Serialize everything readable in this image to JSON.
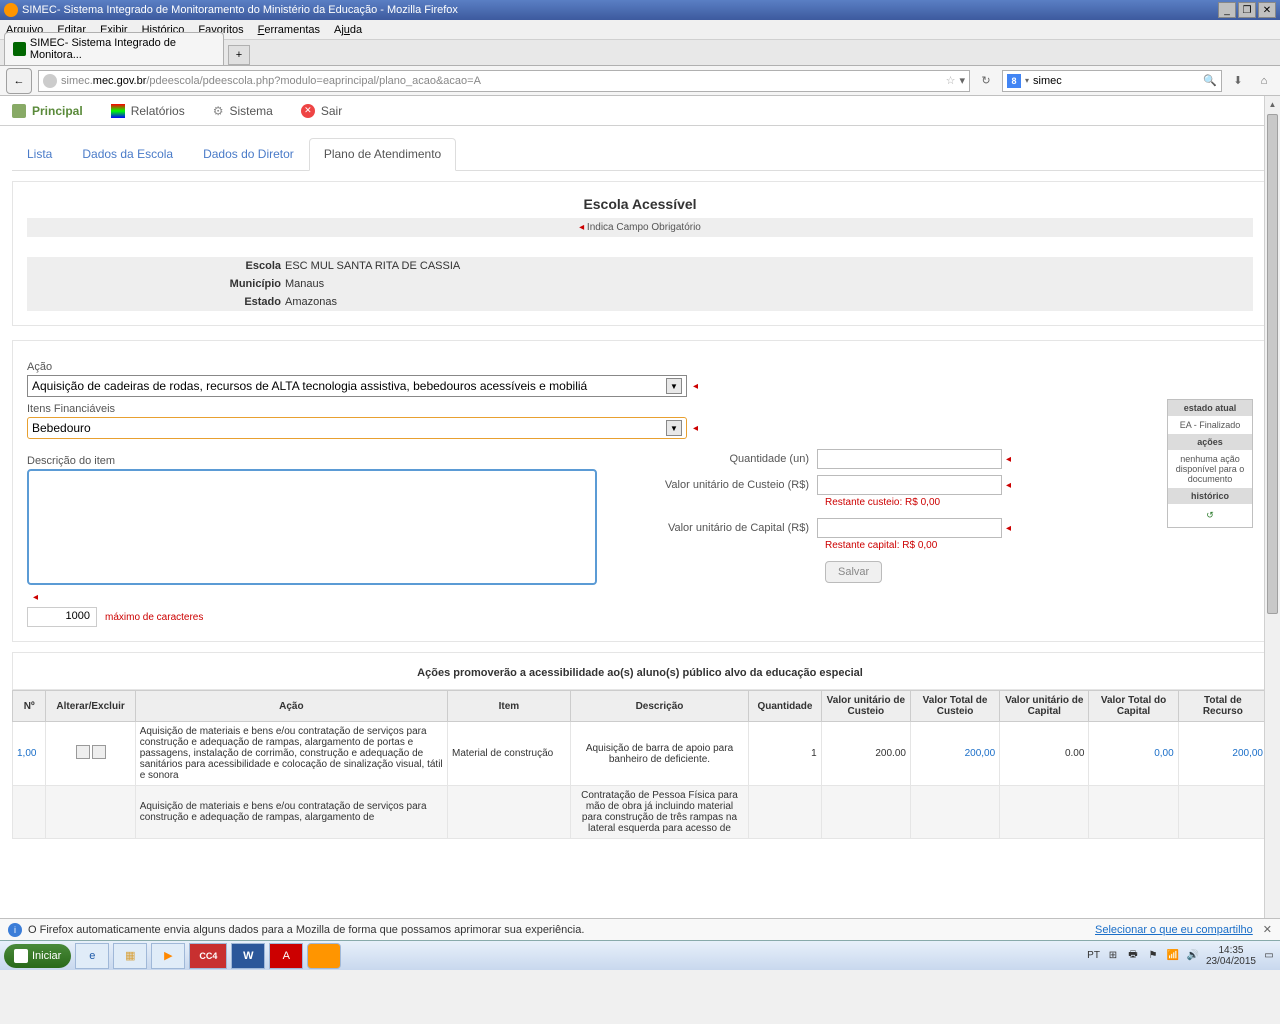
{
  "window": {
    "title": "SIMEC- Sistema Integrado de Monitoramento do Ministério da Educação - Mozilla Firefox"
  },
  "menubar": {
    "arquivo": "Arquivo",
    "editar": "Editar",
    "exibir": "Exibir",
    "historico": "Histórico",
    "favoritos": "Favoritos",
    "ferramentas": "Ferramentas",
    "ajuda": "Ajuda"
  },
  "browser_tab": {
    "label": "SIMEC- Sistema Integrado de Monitora..."
  },
  "url": "simec.mec.gov.br/pdeescola/pdeescola.php?modulo=eaprincipal/plano_acao&acao=A",
  "searchbox": {
    "value": "simec"
  },
  "topnav": {
    "principal": "Principal",
    "relatorios": "Relatórios",
    "sistema": "Sistema",
    "sair": "Sair"
  },
  "tabs": {
    "lista": "Lista",
    "dados_escola": "Dados da Escola",
    "dados_diretor": "Dados do Diretor",
    "plano": "Plano de Atendimento"
  },
  "panel": {
    "title": "Escola Acessível",
    "req_note": "Indica Campo Obrigatório",
    "escola_lbl": "Escola",
    "escola_val": "ESC MUL SANTA RITA DE CASSIA",
    "municipio_lbl": "Município",
    "municipio_val": "Manaus",
    "estado_lbl": "Estado",
    "estado_val": "Amazonas"
  },
  "form": {
    "acao_lbl": "Ação",
    "acao_val": "Aquisição de cadeiras de rodas, recursos de ALTA tecnologia assistiva, bebedouros acessíveis e mobiliá",
    "itens_lbl": "Itens Financiáveis",
    "itens_val": "Bebedouro",
    "desc_lbl": "Descrição do item",
    "counter": "1000",
    "counter_note": "máximo de caracteres",
    "qtd_lbl": "Quantidade (un)",
    "custeio_lbl": "Valor unitário de Custeio (R$)",
    "custeio_remain": "Restante custeio: R$ 0,00",
    "capital_lbl": "Valor unitário de Capital (R$)",
    "capital_remain": "Restante capital: R$ 0,00",
    "save": "Salvar"
  },
  "side": {
    "estado_h": "estado atual",
    "estado_v": "EA - Finalizado",
    "acoes_h": "ações",
    "acoes_v": "nenhuma ação disponível para o documento",
    "hist_h": "histórico"
  },
  "acc_title": "Ações promoverão a acessibilidade ao(s) aluno(s) público alvo da educação especial",
  "table": {
    "headers": [
      "Nº",
      "Alterar/Excluir",
      "Ação",
      "Item",
      "Descrição",
      "Quantidade",
      "Valor unitário de Custeio",
      "Valor Total de Custeio",
      "Valor unitário de Capital",
      "Valor Total do Capital",
      "Total de Recurso"
    ],
    "rows": [
      {
        "n": "1,00",
        "acao": "Aquisição de materiais e bens e/ou contratação de serviços para construção e adequação de rampas, alargamento de portas e passagens, instalação de corrimão, construção e adequação de sanitários para acessibilidade e colocação de sinalização visual, tátil e sonora",
        "item": "Material de construção",
        "desc": "Aquisição de barra de apoio para banheiro de deficiente.",
        "qtd": "1",
        "vuc": "200.00",
        "vtc": "200,00",
        "vucap": "0.00",
        "vtcap": "0,00",
        "total": "200,00"
      },
      {
        "n": "",
        "acao": "Aquisição de materiais e bens e/ou contratação de serviços para construção e adequação de rampas, alargamento de",
        "item": "",
        "desc": "Contratação de Pessoa Física para mão de obra já incluindo material para construção de três rampas na lateral esquerda para acesso de",
        "qtd": "",
        "vuc": "",
        "vtc": "",
        "vucap": "",
        "vtcap": "",
        "total": ""
      }
    ]
  },
  "notif": {
    "text": "O Firefox automaticamente envia alguns dados para a Mozilla de forma que possamos aprimorar sua experiência.",
    "action": "Selecionar o que eu compartilho"
  },
  "taskbar": {
    "start": "Iniciar",
    "lang": "PT",
    "time": "14:35",
    "date": "23/04/2015"
  }
}
